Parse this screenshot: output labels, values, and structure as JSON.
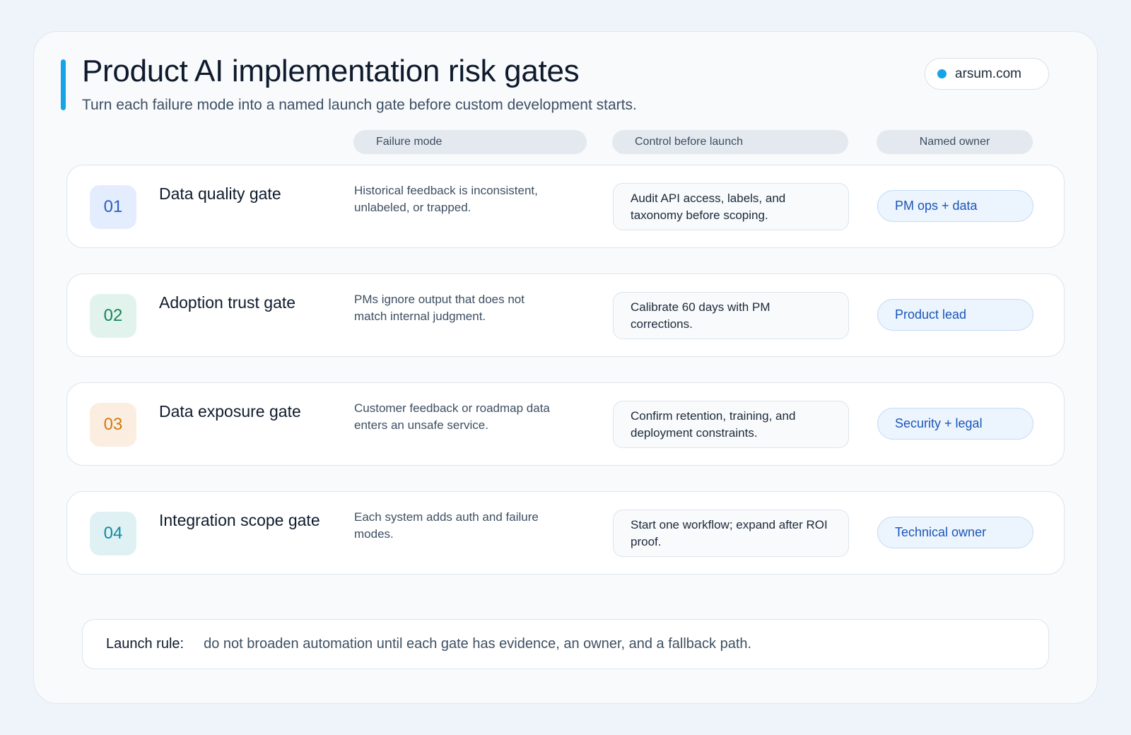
{
  "header": {
    "title": "Product AI implementation risk gates",
    "subtitle": "Turn each failure mode into a named launch gate before custom development starts.",
    "site": "arsum.com"
  },
  "columns": {
    "failure": "Failure mode",
    "control": "Control before launch",
    "owner": "Named owner"
  },
  "rows": [
    {
      "num": "01",
      "title": "Data quality gate",
      "failure": "Historical feedback is inconsistent, unlabeled, or trapped.",
      "control": "Audit API access, labels, and taxonomy before scoping.",
      "owner": "PM ops + data",
      "num_bg": "#e4edfd",
      "num_color": "#2c5fc4"
    },
    {
      "num": "02",
      "title": "Adoption trust gate",
      "failure": "PMs ignore output that does not match internal judgment.",
      "control": "Calibrate 60 days with PM corrections.",
      "owner": "Product lead",
      "num_bg": "#e1f3ec",
      "num_color": "#14865a"
    },
    {
      "num": "03",
      "title": "Data exposure gate",
      "failure": "Customer feedback or roadmap data enters an unsafe service.",
      "control": "Confirm retention, training, and deployment constraints.",
      "owner": "Security + legal",
      "num_bg": "#fbeee1",
      "num_color": "#cf7a12"
    },
    {
      "num": "04",
      "title": "Integration scope gate",
      "failure": "Each system adds auth and failure modes.",
      "control": "Start one workflow; expand after ROI proof.",
      "owner": "Technical owner",
      "num_bg": "#e0f1f4",
      "num_color": "#118aa3"
    }
  ],
  "launch": {
    "label": "Launch rule:",
    "text": "do not broaden automation until each gate has evidence, an owner, and a fallback path."
  }
}
